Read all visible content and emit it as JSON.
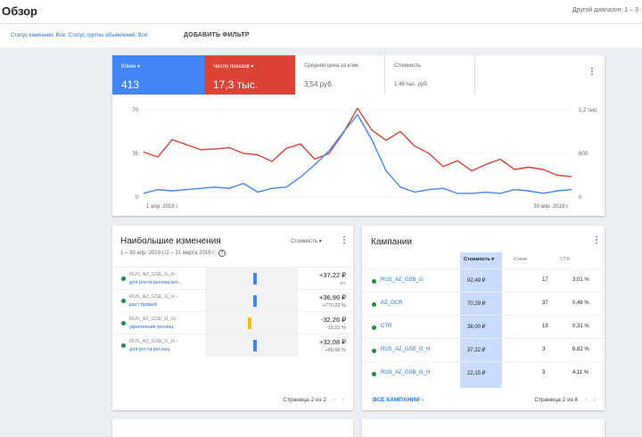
{
  "header": {
    "title": "Обзор",
    "range": "Другой диапазон: 1 – 3"
  },
  "filters": {
    "text": "Статус кампании: Все; Статус группы объявлений: Все",
    "add_filter": "ДОБАВИТЬ ФИЛЬТР"
  },
  "metrics": [
    {
      "label": "Клики ▾",
      "value": "413",
      "color": "#4285f4"
    },
    {
      "label": "Число показов ▾",
      "value": "17,3 тыс.",
      "color": "#db4437"
    },
    {
      "label": "Средняя цена за клик",
      "value": "3,54 руб."
    },
    {
      "label": "Стоимость",
      "value": "1,46 тыс. руб."
    }
  ],
  "chart_data": {
    "type": "line",
    "x_start_label": "1 апр. 2019 г.",
    "x_end_label": "30 апр. 2019 г.",
    "left_ticks": [
      "70",
      "35",
      "0"
    ],
    "right_ticks": [
      "1,2 тыс.",
      "600",
      "0"
    ],
    "ylim_left": [
      0,
      70
    ],
    "ylim_right": [
      0,
      1200
    ],
    "series": [
      {
        "name": "Клики",
        "color": "#4285f4",
        "axis": "left",
        "values": [
          3,
          6,
          5,
          6,
          7,
          8,
          7,
          11,
          4,
          7,
          8,
          16,
          26,
          37,
          52,
          66,
          46,
          21,
          8,
          4,
          6,
          7,
          3,
          3,
          4,
          3,
          6,
          5,
          3,
          5,
          6
        ]
      },
      {
        "name": "Число показов",
        "color": "#db4437",
        "axis": "right",
        "values": [
          620,
          550,
          790,
          720,
          650,
          660,
          680,
          600,
          580,
          490,
          670,
          730,
          520,
          600,
          880,
          1220,
          920,
          780,
          900,
          700,
          600,
          420,
          500,
          360,
          450,
          520,
          380,
          410,
          380,
          300,
          280
        ]
      }
    ]
  },
  "changes": {
    "title": "Наибольшие изменения",
    "subtitle": "1 – 30 апр. 2019 г./2 – 31 марта 2019 г.",
    "dropdown": "Стоимость ▾",
    "rows": [
      {
        "line1": "RUS_AZ_GSE_G_H -",
        "line2": "для роста ресниц куп...",
        "value": "+37,22 ₽",
        "delta": "+∞",
        "bar_color": "#4285f4",
        "bar_dir": "up"
      },
      {
        "line1": "RUS_AZ_GSE_G_H -",
        "line2": "рост бровей",
        "value": "+36,96 ₽",
        "delta": "+770,22 %",
        "bar_color": "#4285f4",
        "bar_dir": "up"
      },
      {
        "line1": "RUS_AZ_GSE_H_01 -",
        "line2": "укрепление ресниц",
        "value": "-32,26 ₽",
        "delta": "-15,01 %",
        "bar_color": "#fbbc04",
        "bar_dir": "down"
      },
      {
        "line1": "RUS_AZ_GSE_G_H -",
        "line2": "для роста ресниц",
        "value": "+32,08 ₽",
        "delta": "+69,66 %",
        "bar_color": "#4285f4",
        "bar_dir": "up"
      }
    ],
    "pager": "Страница 2 из 2"
  },
  "campaigns": {
    "title": "Кампании",
    "columns": [
      "Стоимость ▾",
      "Клики",
      "CTR"
    ],
    "rows": [
      {
        "name": "RUS_AZ_GSB_G",
        "cost": "92,49 ₽",
        "clicks": "17",
        "ctr": "3,01 %"
      },
      {
        "name": "AZ_GCR",
        "cost": "70,29 ₽",
        "clicks": "37",
        "ctr": "0,46 %"
      },
      {
        "name": "CTR",
        "cost": "38,00 ₽",
        "clicks": "19",
        "ctr": "0,31 %"
      },
      {
        "name": "RUS_AZ_GSE_G_H",
        "cost": "37,22 ₽",
        "clicks": "3",
        "ctr": "6,82 %"
      },
      {
        "name": "RUS_AZ_GSB_G_H",
        "cost": "22,15 ₽",
        "clicks": "3",
        "ctr": "4,11 %"
      }
    ],
    "all_link": "ВСЕ КАМПАНИИ",
    "pager": "Страница 2 из 8"
  }
}
